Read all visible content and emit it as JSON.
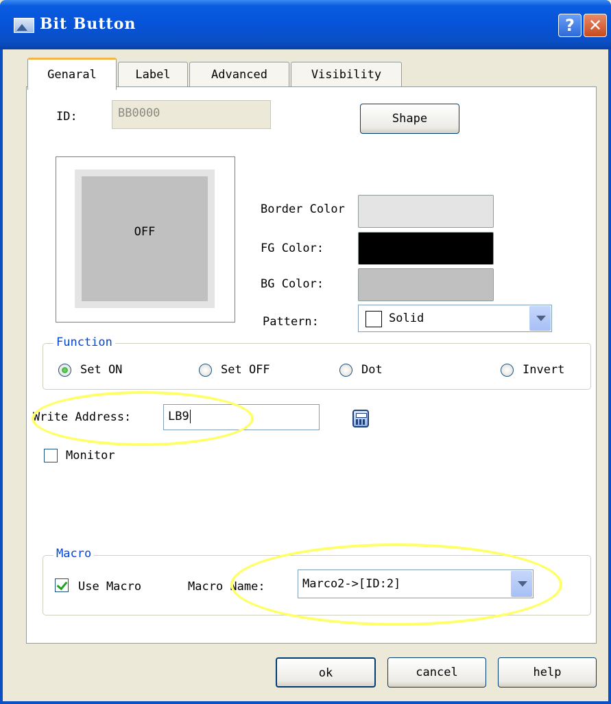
{
  "window": {
    "title": "Bit Button",
    "help_glyph": "?",
    "close_glyph": "✕"
  },
  "tabs": [
    {
      "label": "Genaral",
      "active": true
    },
    {
      "label": "Label",
      "active": false
    },
    {
      "label": "Advanced",
      "active": false
    },
    {
      "label": "Visibility",
      "active": false
    }
  ],
  "general": {
    "id_label": "ID:",
    "id_value": "BB0000",
    "shape_button": "Shape",
    "preview_text": "OFF",
    "border_color_label": "Border Color",
    "border_color_value": "#e4e4e4",
    "fg_color_label": "FG Color:",
    "fg_color_value": "#000000",
    "bg_color_label": "BG Color:",
    "bg_color_value": "#c0c0c0",
    "pattern_label": "Pattern:",
    "pattern_value": "Solid"
  },
  "function": {
    "title": "Function",
    "options": [
      {
        "label": "Set ON",
        "selected": true
      },
      {
        "label": "Set OFF",
        "selected": false
      },
      {
        "label": "Dot",
        "selected": false
      },
      {
        "label": "Invert",
        "selected": false
      }
    ]
  },
  "write_address": {
    "label": "Write Address:",
    "value": "LB9"
  },
  "monitor": {
    "label": "Monitor",
    "checked": false
  },
  "macro": {
    "title": "Macro",
    "use_macro_label": "Use Macro",
    "use_macro_checked": true,
    "name_label": "Macro Name:",
    "name_value": "Marco2->[ID:2]"
  },
  "buttons": {
    "ok": "ok",
    "cancel": "cancel",
    "help": "help"
  },
  "annotations": {
    "highlight_color": "#ffff66"
  }
}
